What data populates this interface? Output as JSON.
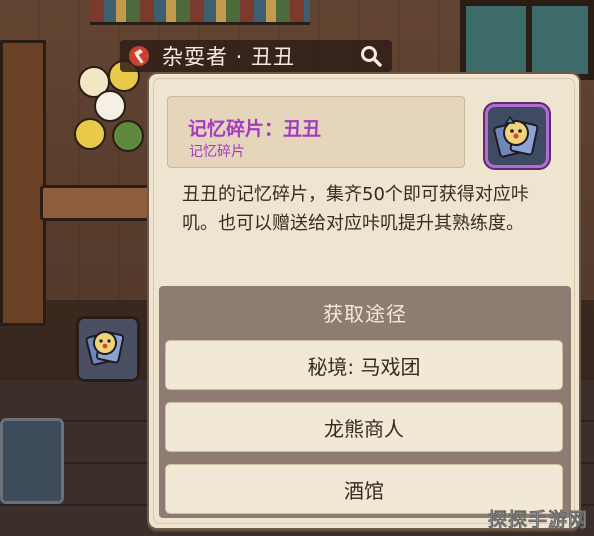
{
  "header": {
    "title": "杂耍者 · 丑丑",
    "category_icon": "hammer-icon",
    "search_icon": "search-icon"
  },
  "item": {
    "name": "记忆碎片：丑丑",
    "type": "记忆碎片",
    "icon": "clown-memory-fragment-icon",
    "description": "丑丑的记忆碎片，集齐50个即可获得对应咔叽。也可以赠送给对应咔叽提升其熟练度。"
  },
  "sources": {
    "title": "获取途径",
    "items": [
      {
        "label": "秘境: 马戏团"
      },
      {
        "label": "龙熊商人"
      },
      {
        "label": "酒馆"
      }
    ]
  },
  "watermark": "探探手游网",
  "colors": {
    "item_name": "#a33bc2",
    "panel_bg": "#efe4cf",
    "sources_bg": "#8e7b72",
    "source_button_bg": "#f2e8d6"
  }
}
